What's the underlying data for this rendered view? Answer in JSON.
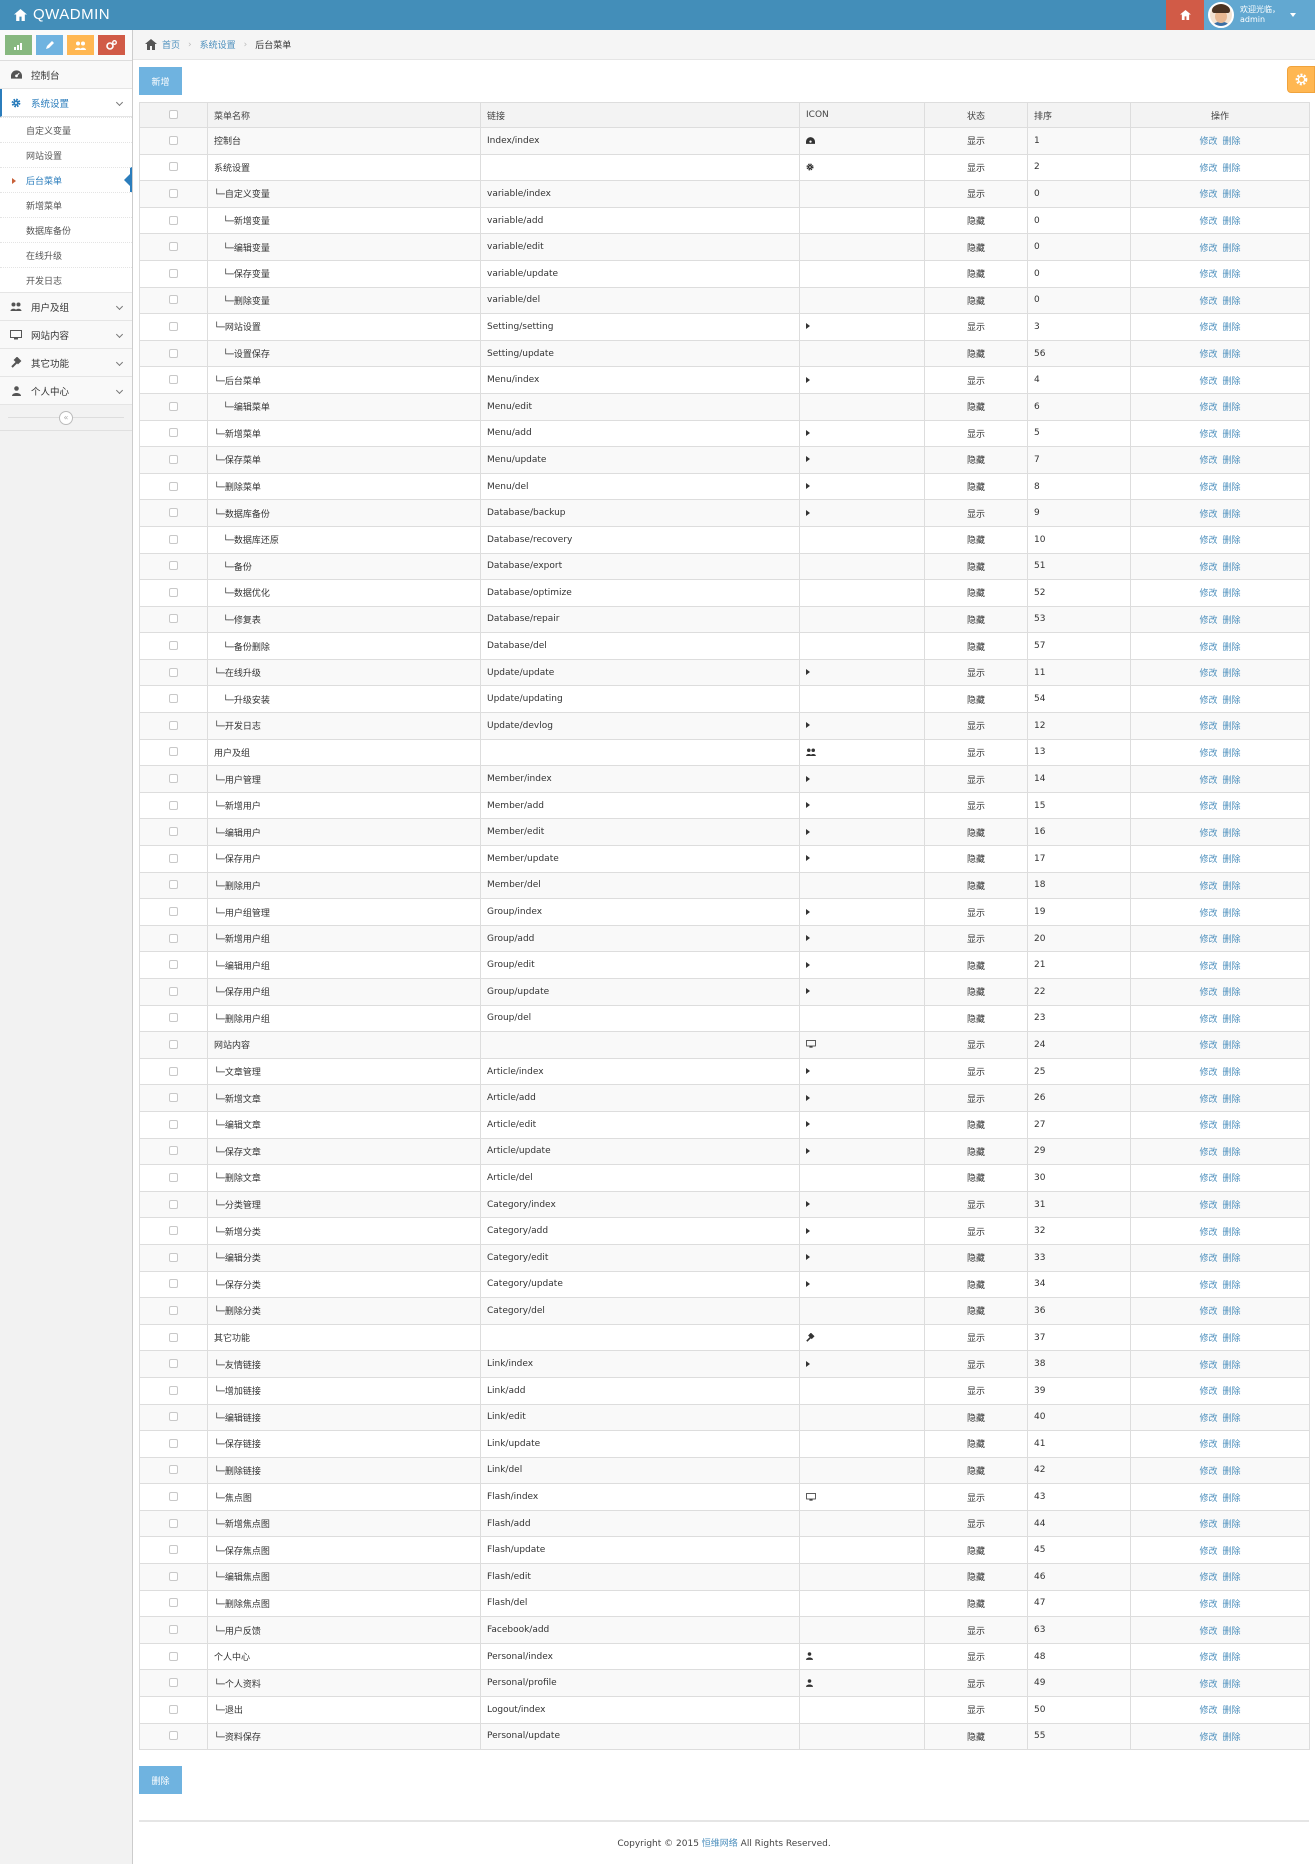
{
  "navbar": {
    "brand": "QWADMIN",
    "welcome": "欢迎光临，",
    "username": "admin"
  },
  "sidebar": {
    "items": [
      {
        "label": "控制台",
        "icon": "dashboard-icon"
      },
      {
        "label": "系统设置",
        "icon": "gear-icon",
        "active": true,
        "children": [
          "自定义变量",
          "网站设置",
          "后台菜单",
          "新增菜单",
          "数据库备份",
          "在线升级",
          "开发日志"
        ],
        "active_child": "后台菜单"
      },
      {
        "label": "用户及组",
        "icon": "users-icon"
      },
      {
        "label": "网站内容",
        "icon": "desktop-icon"
      },
      {
        "label": "其它功能",
        "icon": "wrench-icon"
      },
      {
        "label": "个人中心",
        "icon": "user-icon"
      }
    ]
  },
  "breadcrumb": {
    "home": "首页",
    "section": "系统设置",
    "current": "后台菜单"
  },
  "buttons": {
    "add": "新增",
    "delete": "删除"
  },
  "table": {
    "headers": {
      "name": "菜单名称",
      "link": "链接",
      "icon": "ICON",
      "status": "状态",
      "order": "排序",
      "ops": "操作"
    },
    "op_edit": "修改",
    "op_delete": "删除",
    "rows": [
      {
        "name": "控制台",
        "link": "Index/index",
        "icon": "dashboard",
        "status": "显示",
        "order": "1"
      },
      {
        "name": "系统设置",
        "link": "",
        "icon": "gear",
        "status": "显示",
        "order": "2"
      },
      {
        "name": "└─自定义变量",
        "link": "variable/index",
        "icon": "",
        "status": "显示",
        "order": "0"
      },
      {
        "name": "　└─新增变量",
        "link": "variable/add",
        "icon": "",
        "status": "隐藏",
        "order": "0"
      },
      {
        "name": "　└─编辑变量",
        "link": "variable/edit",
        "icon": "",
        "status": "隐藏",
        "order": "0"
      },
      {
        "name": "　└─保存变量",
        "link": "variable/update",
        "icon": "",
        "status": "隐藏",
        "order": "0"
      },
      {
        "name": "　└─删除变量",
        "link": "variable/del",
        "icon": "",
        "status": "隐藏",
        "order": "0"
      },
      {
        "name": "└─网站设置",
        "link": "Setting/setting",
        "icon": "caret",
        "status": "显示",
        "order": "3"
      },
      {
        "name": "　└─设置保存",
        "link": "Setting/update",
        "icon": "",
        "status": "隐藏",
        "order": "56"
      },
      {
        "name": "└─后台菜单",
        "link": "Menu/index",
        "icon": "caret",
        "status": "显示",
        "order": "4"
      },
      {
        "name": "　└─编辑菜单",
        "link": "Menu/edit",
        "icon": "",
        "status": "隐藏",
        "order": "6"
      },
      {
        "name": "└─新增菜单",
        "link": "Menu/add",
        "icon": "caret",
        "status": "显示",
        "order": "5"
      },
      {
        "name": "└─保存菜单",
        "link": "Menu/update",
        "icon": "caret",
        "status": "隐藏",
        "order": "7"
      },
      {
        "name": "└─删除菜单",
        "link": "Menu/del",
        "icon": "caret",
        "status": "隐藏",
        "order": "8"
      },
      {
        "name": "└─数据库备份",
        "link": "Database/backup",
        "icon": "caret",
        "status": "显示",
        "order": "9"
      },
      {
        "name": "　└─数据库还原",
        "link": "Database/recovery",
        "icon": "",
        "status": "隐藏",
        "order": "10"
      },
      {
        "name": "　└─备份",
        "link": "Database/export",
        "icon": "",
        "status": "隐藏",
        "order": "51"
      },
      {
        "name": "　└─数据优化",
        "link": "Database/optimize",
        "icon": "",
        "status": "隐藏",
        "order": "52"
      },
      {
        "name": "　└─修复表",
        "link": "Database/repair",
        "icon": "",
        "status": "隐藏",
        "order": "53"
      },
      {
        "name": "　└─备份删除",
        "link": "Database/del",
        "icon": "",
        "status": "隐藏",
        "order": "57"
      },
      {
        "name": "└─在线升级",
        "link": "Update/update",
        "icon": "caret",
        "status": "显示",
        "order": "11"
      },
      {
        "name": "　└─升级安装",
        "link": "Update/updating",
        "icon": "",
        "status": "隐藏",
        "order": "54"
      },
      {
        "name": "└─开发日志",
        "link": "Update/devlog",
        "icon": "caret",
        "status": "显示",
        "order": "12"
      },
      {
        "name": "用户及组",
        "link": "",
        "icon": "users",
        "status": "显示",
        "order": "13"
      },
      {
        "name": "└─用户管理",
        "link": "Member/index",
        "icon": "caret",
        "status": "显示",
        "order": "14"
      },
      {
        "name": "└─新增用户",
        "link": "Member/add",
        "icon": "caret",
        "status": "显示",
        "order": "15"
      },
      {
        "name": "└─编辑用户",
        "link": "Member/edit",
        "icon": "caret",
        "status": "隐藏",
        "order": "16"
      },
      {
        "name": "└─保存用户",
        "link": "Member/update",
        "icon": "caret",
        "status": "隐藏",
        "order": "17"
      },
      {
        "name": "└─删除用户",
        "link": "Member/del",
        "icon": "",
        "status": "隐藏",
        "order": "18"
      },
      {
        "name": "└─用户组管理",
        "link": "Group/index",
        "icon": "caret",
        "status": "显示",
        "order": "19"
      },
      {
        "name": "└─新增用户组",
        "link": "Group/add",
        "icon": "caret",
        "status": "显示",
        "order": "20"
      },
      {
        "name": "└─编辑用户组",
        "link": "Group/edit",
        "icon": "caret",
        "status": "隐藏",
        "order": "21"
      },
      {
        "name": "└─保存用户组",
        "link": "Group/update",
        "icon": "caret",
        "status": "隐藏",
        "order": "22"
      },
      {
        "name": "└─删除用户组",
        "link": "Group/del",
        "icon": "",
        "status": "隐藏",
        "order": "23"
      },
      {
        "name": "网站内容",
        "link": "",
        "icon": "desktop",
        "status": "显示",
        "order": "24"
      },
      {
        "name": "└─文章管理",
        "link": "Article/index",
        "icon": "caret",
        "status": "显示",
        "order": "25"
      },
      {
        "name": "└─新增文章",
        "link": "Article/add",
        "icon": "caret",
        "status": "显示",
        "order": "26"
      },
      {
        "name": "└─编辑文章",
        "link": "Article/edit",
        "icon": "caret",
        "status": "隐藏",
        "order": "27"
      },
      {
        "name": "└─保存文章",
        "link": "Article/update",
        "icon": "caret",
        "status": "隐藏",
        "order": "29"
      },
      {
        "name": "└─删除文章",
        "link": "Article/del",
        "icon": "",
        "status": "隐藏",
        "order": "30"
      },
      {
        "name": "└─分类管理",
        "link": "Category/index",
        "icon": "caret",
        "status": "显示",
        "order": "31"
      },
      {
        "name": "└─新增分类",
        "link": "Category/add",
        "icon": "caret",
        "status": "显示",
        "order": "32"
      },
      {
        "name": "└─编辑分类",
        "link": "Category/edit",
        "icon": "caret",
        "status": "隐藏",
        "order": "33"
      },
      {
        "name": "└─保存分类",
        "link": "Category/update",
        "icon": "caret",
        "status": "隐藏",
        "order": "34"
      },
      {
        "name": "└─删除分类",
        "link": "Category/del",
        "icon": "",
        "status": "隐藏",
        "order": "36"
      },
      {
        "name": "其它功能",
        "link": "",
        "icon": "wrench",
        "status": "显示",
        "order": "37"
      },
      {
        "name": "└─友情链接",
        "link": "Link/index",
        "icon": "caret",
        "status": "显示",
        "order": "38"
      },
      {
        "name": "└─增加链接",
        "link": "Link/add",
        "icon": "",
        "status": "显示",
        "order": "39"
      },
      {
        "name": "└─编辑链接",
        "link": "Link/edit",
        "icon": "",
        "status": "隐藏",
        "order": "40"
      },
      {
        "name": "└─保存链接",
        "link": "Link/update",
        "icon": "",
        "status": "隐藏",
        "order": "41"
      },
      {
        "name": "└─删除链接",
        "link": "Link/del",
        "icon": "",
        "status": "隐藏",
        "order": "42"
      },
      {
        "name": "└─焦点图",
        "link": "Flash/index",
        "icon": "desktop",
        "status": "显示",
        "order": "43"
      },
      {
        "name": "└─新增焦点图",
        "link": "Flash/add",
        "icon": "",
        "status": "显示",
        "order": "44"
      },
      {
        "name": "└─保存焦点图",
        "link": "Flash/update",
        "icon": "",
        "status": "隐藏",
        "order": "45"
      },
      {
        "name": "└─编辑焦点图",
        "link": "Flash/edit",
        "icon": "",
        "status": "隐藏",
        "order": "46"
      },
      {
        "name": "└─删除焦点图",
        "link": "Flash/del",
        "icon": "",
        "status": "隐藏",
        "order": "47"
      },
      {
        "name": "└─用户反馈",
        "link": "Facebook/add",
        "icon": "",
        "status": "显示",
        "order": "63"
      },
      {
        "name": "个人中心",
        "link": "Personal/index",
        "icon": "user",
        "status": "显示",
        "order": "48"
      },
      {
        "name": "└─个人资料",
        "link": "Personal/profile",
        "icon": "user",
        "status": "显示",
        "order": "49"
      },
      {
        "name": "└─退出",
        "link": "Logout/index",
        "icon": "",
        "status": "显示",
        "order": "50"
      },
      {
        "name": "└─资料保存",
        "link": "Personal/update",
        "icon": "",
        "status": "隐藏",
        "order": "55"
      }
    ]
  },
  "footer": {
    "prefix": "Copyright © 2015 ",
    "company": "恒维网络",
    "suffix": " All Rights Reserved."
  },
  "colors": {
    "navbar": "#438eb9",
    "accent": "#2b7dbc",
    "link": "#4c8fbd",
    "btn": "#6fb3e0",
    "home": "#d15b47",
    "user": "#62a8d1",
    "gear": "#ffb752"
  }
}
